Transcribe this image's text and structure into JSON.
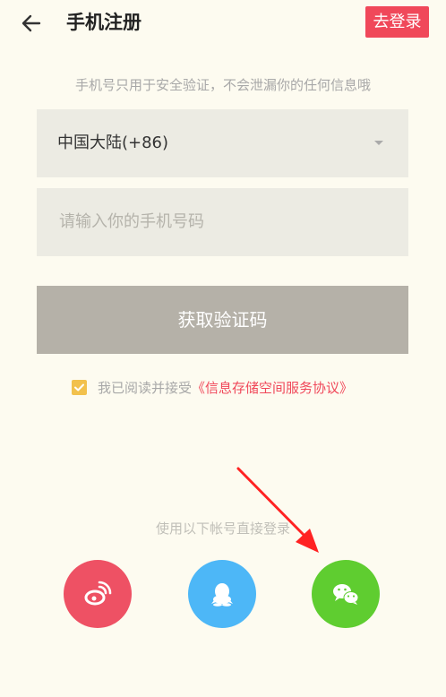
{
  "header": {
    "title": "手机注册",
    "login_label": "去登录"
  },
  "hint": "手机号只用于安全验证，不会泄漏你的任何信息哦",
  "country": {
    "selected": "中国大陆(+86)"
  },
  "phone": {
    "placeholder": "请输入你的手机号码"
  },
  "code_button": "获取验证码",
  "agreement": {
    "text": "我已阅读并接受",
    "link": "《信息存储空间服务协议》",
    "checked": true
  },
  "social": {
    "hint": "使用以下帐号直接登录",
    "providers": [
      "weibo-icon",
      "qq-icon",
      "wechat-icon"
    ]
  },
  "colors": {
    "accent": "#f0485a",
    "background": "#fdfbf0",
    "weibo": "#ee5164",
    "qq": "#4db7f7",
    "wechat": "#5fcd30",
    "checkbox": "#f2c14d"
  }
}
